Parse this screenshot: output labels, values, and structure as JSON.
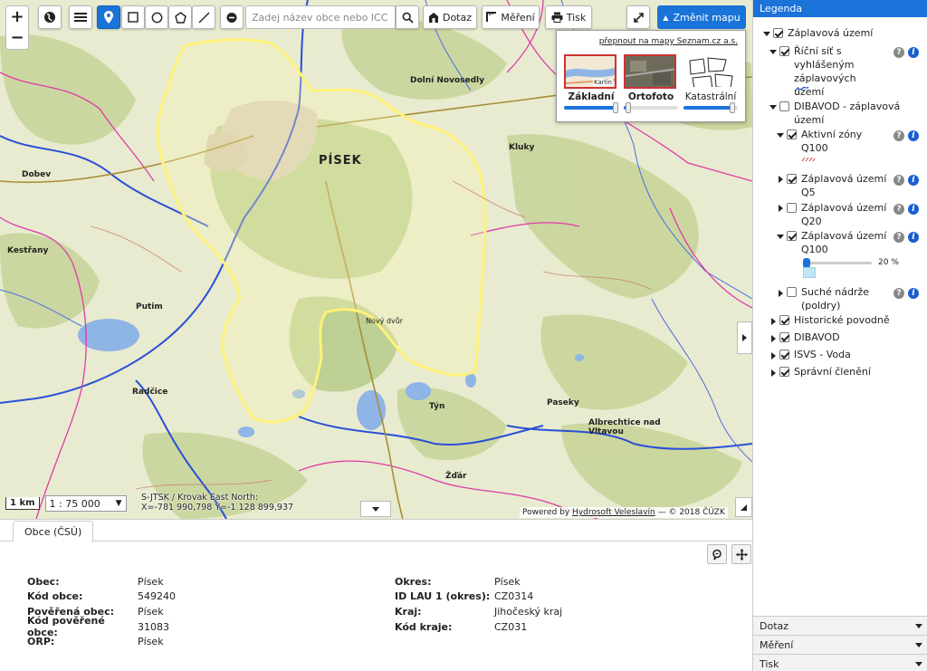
{
  "toolbar": {
    "search_placeholder": "Zadej název obce nebo ICC",
    "dotaz_label": "Dotaz",
    "mereni_label": "Měření",
    "tisk_label": "Tisk",
    "change_map_label": "Změnit mapu",
    "zoom_in": "+",
    "zoom_out": "−"
  },
  "basemap_panel": {
    "seznam_link": "přepnout na mapy Seznam.cz a.s.",
    "options": [
      {
        "name": "Základní",
        "selected": true,
        "opacity": 0.95,
        "thumb_label": "Karlín"
      },
      {
        "name": "Ortofoto",
        "selected": false,
        "opacity": 0.08
      },
      {
        "name": "Katastrální",
        "selected": false,
        "opacity": 0.9
      }
    ]
  },
  "map": {
    "town_label": "PÍSEK",
    "scale_unit": "1 km",
    "scale_value": "1 : 75 000",
    "coords_line1": "S-JTSK / Krovak East North:",
    "coords_line2": "X=-781 990,798 Y=-1 128 899,937",
    "powered_prefix": "Powered by",
    "powered_link": "Hydrosoft Veleslavín",
    "powered_suffix": "— © 2018 ČÚZK",
    "labels": [
      "Dobev",
      "Kestřany",
      "Putim",
      "Radčice",
      "Kluky",
      "Paseky",
      "Albrechtice nad Vltavou",
      "Žďár",
      "Týn",
      "Dolní Novosedly",
      "Nový dvůr"
    ]
  },
  "bottom": {
    "tab_label": "Obce (ČSÚ)",
    "left": [
      {
        "key": "Obec:",
        "value": "Písek"
      },
      {
        "key": "Kód obce:",
        "value": "549240"
      },
      {
        "key": "Pověřená obec:",
        "value": "Písek"
      },
      {
        "key": "Kód pověřené obce:",
        "value": "31083"
      },
      {
        "key": "ORP:",
        "value": "Písek"
      }
    ],
    "right": [
      {
        "key": "Okres:",
        "value": "Písek"
      },
      {
        "key": "ID LAU 1 (okres):",
        "value": "CZ0314"
      },
      {
        "key": "Kraj:",
        "value": "Jihočeský kraj"
      },
      {
        "key": "Kód kraje:",
        "value": "CZ031"
      }
    ]
  },
  "legend": {
    "title": "Legenda",
    "items": [
      {
        "label": "Záplavová území"
      },
      {
        "label": "Říční síť s vyhlášeným záplavových území"
      },
      {
        "label": "DIBAVOD - záplavová území"
      },
      {
        "label": "Aktivní zóny Q100"
      },
      {
        "label": "Záplavová území Q5"
      },
      {
        "label": "Záplavová území Q20"
      },
      {
        "label": "Záplavová území Q100"
      },
      {
        "label": "Suché nádrže (poldry)"
      },
      {
        "label": "Historické povodně"
      },
      {
        "label": "DIBAVOD"
      },
      {
        "label": "ISVS - Voda"
      },
      {
        "label": "Správní členění"
      }
    ],
    "q100_opacity": "20 %",
    "accordion": [
      "Dotaz",
      "Měření",
      "Tisk"
    ]
  },
  "colors": {
    "accent": "#1a73d9",
    "flood_outline": "#fff27a",
    "river": "#2a4fd6",
    "boundary": "#e03aa8"
  }
}
